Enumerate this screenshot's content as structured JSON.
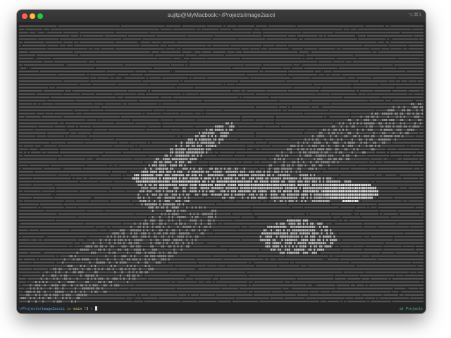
{
  "window": {
    "title": "sujitp@MyMacbook:~/Projects/image2ascii",
    "shortcut": "⌥⌘1"
  },
  "terminal": {
    "content_description_icon": "ascii-art-airplane",
    "prompt": {
      "path": "~/Projects/image2ascii",
      "branch_separator": "on",
      "branch": "main",
      "status": "!3",
      "symbol": "›"
    },
    "right_prompt": "at Projects"
  },
  "colors": {
    "terminal_bg": "#252525",
    "ascii_dark": "#3a3a3a",
    "ascii_light": "#d8d8d8",
    "path": "#5ba9ff",
    "branch": "#d6c35a",
    "right_prompt": "#4fc08d"
  }
}
